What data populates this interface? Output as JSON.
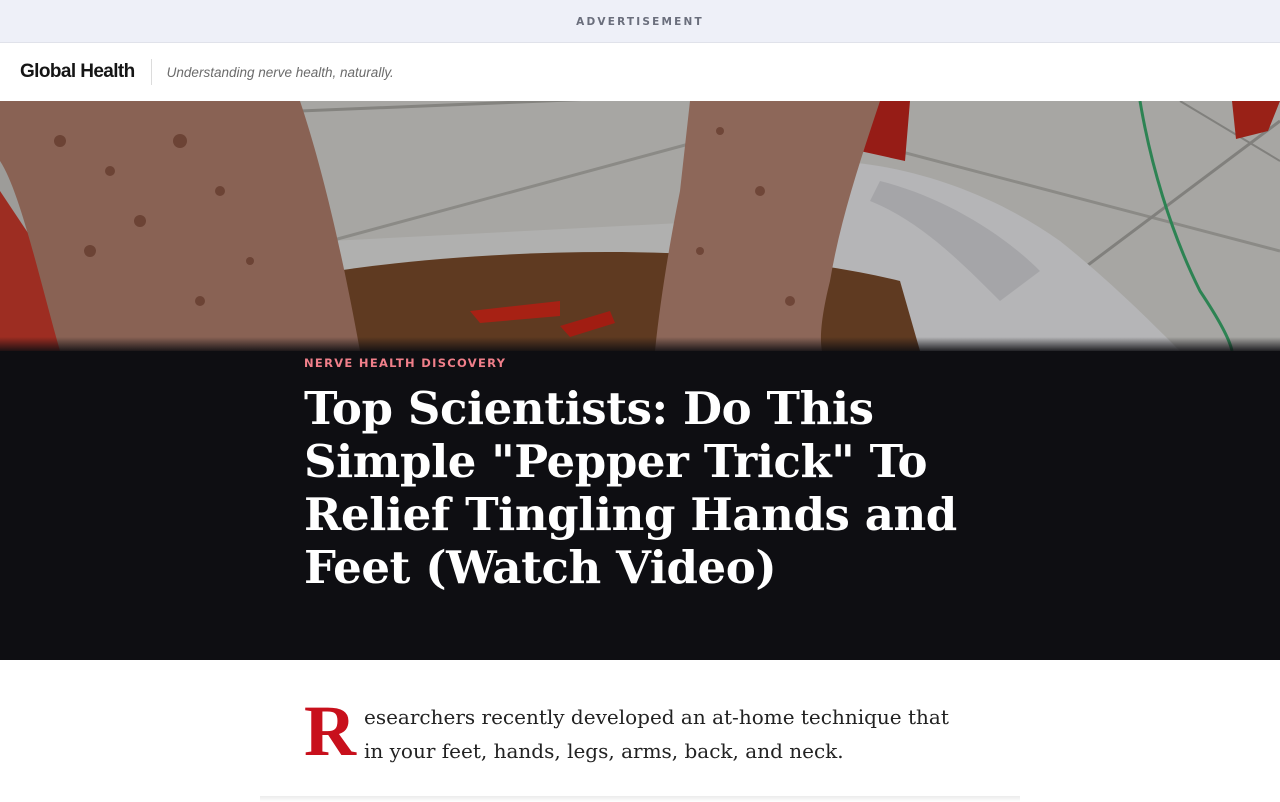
{
  "ad": {
    "label": "ADVERTISEMENT"
  },
  "header": {
    "brand": "Global Health",
    "tagline": "Understanding nerve health, naturally."
  },
  "hero": {
    "kicker": "NERVE HEALTH DISCOVERY",
    "headline": "Top Scientists: Do This Simple \"Pepper Trick\" To Relief Tingling Hands and Feet (Watch Video)"
  },
  "article": {
    "dropcap": "R",
    "lead_line_1": "esearchers recently developed an at-home technique that",
    "lead_line_2": "in your feet, hands, legs, arms, back, and neck."
  },
  "colors": {
    "accent_red": "#c8101c",
    "kicker_pink": "#f07f8a",
    "hero_bg": "#0e0e12",
    "ad_bar_bg": "#eef0f8"
  }
}
